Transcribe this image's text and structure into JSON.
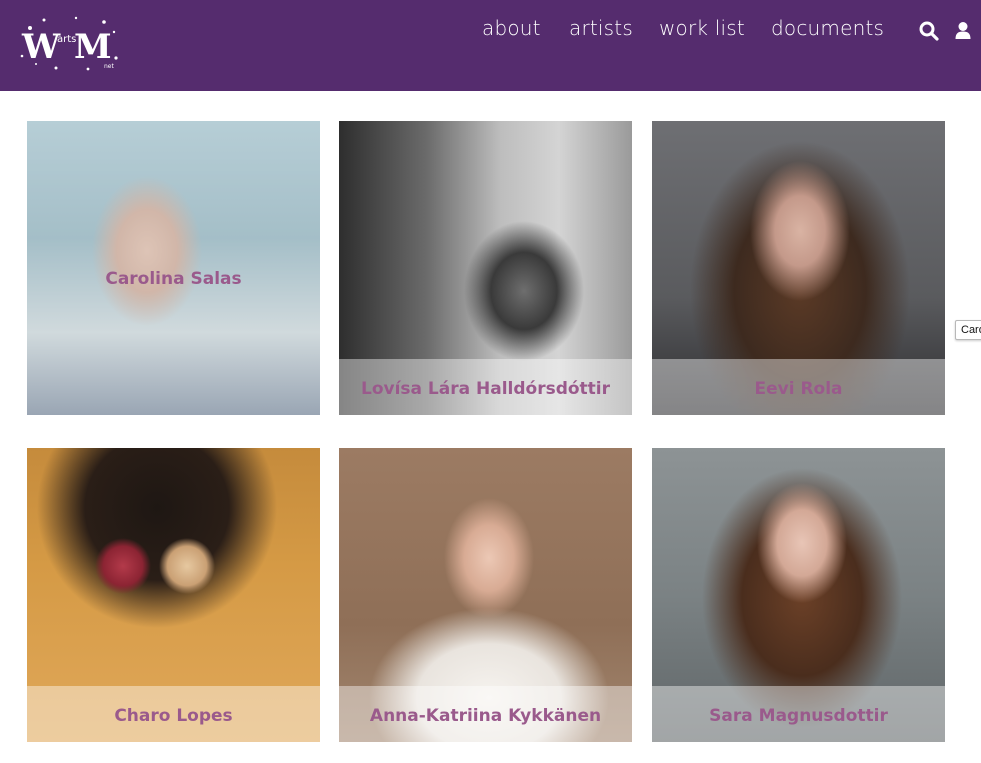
{
  "header": {
    "logo_text": {
      "w": "W",
      "arts": "arts",
      "m": "M",
      "net": "net"
    },
    "nav": [
      {
        "label": "about"
      },
      {
        "label": "artists"
      },
      {
        "label": "work list"
      },
      {
        "label": "documents"
      }
    ],
    "icons": [
      "search-icon",
      "user-icon"
    ]
  },
  "artists": [
    {
      "name": "Carolina Salas",
      "caption_style": "overlay"
    },
    {
      "name": "Lovísa Lára Halldórsdóttir",
      "caption_style": "band"
    },
    {
      "name": "Eevi Rola",
      "caption_style": "band"
    },
    {
      "name": "Charo Lopes",
      "caption_style": "band"
    },
    {
      "name": "Anna-Katriina Kykkänen",
      "caption_style": "band"
    },
    {
      "name": "Sara Magnusdottir",
      "caption_style": "band"
    }
  ],
  "tooltip": {
    "text": "Carolina Salas"
  },
  "colors": {
    "header_bg": "#552c6e",
    "name_text": "#9a5a8c",
    "nav_text": "#ffffff"
  }
}
